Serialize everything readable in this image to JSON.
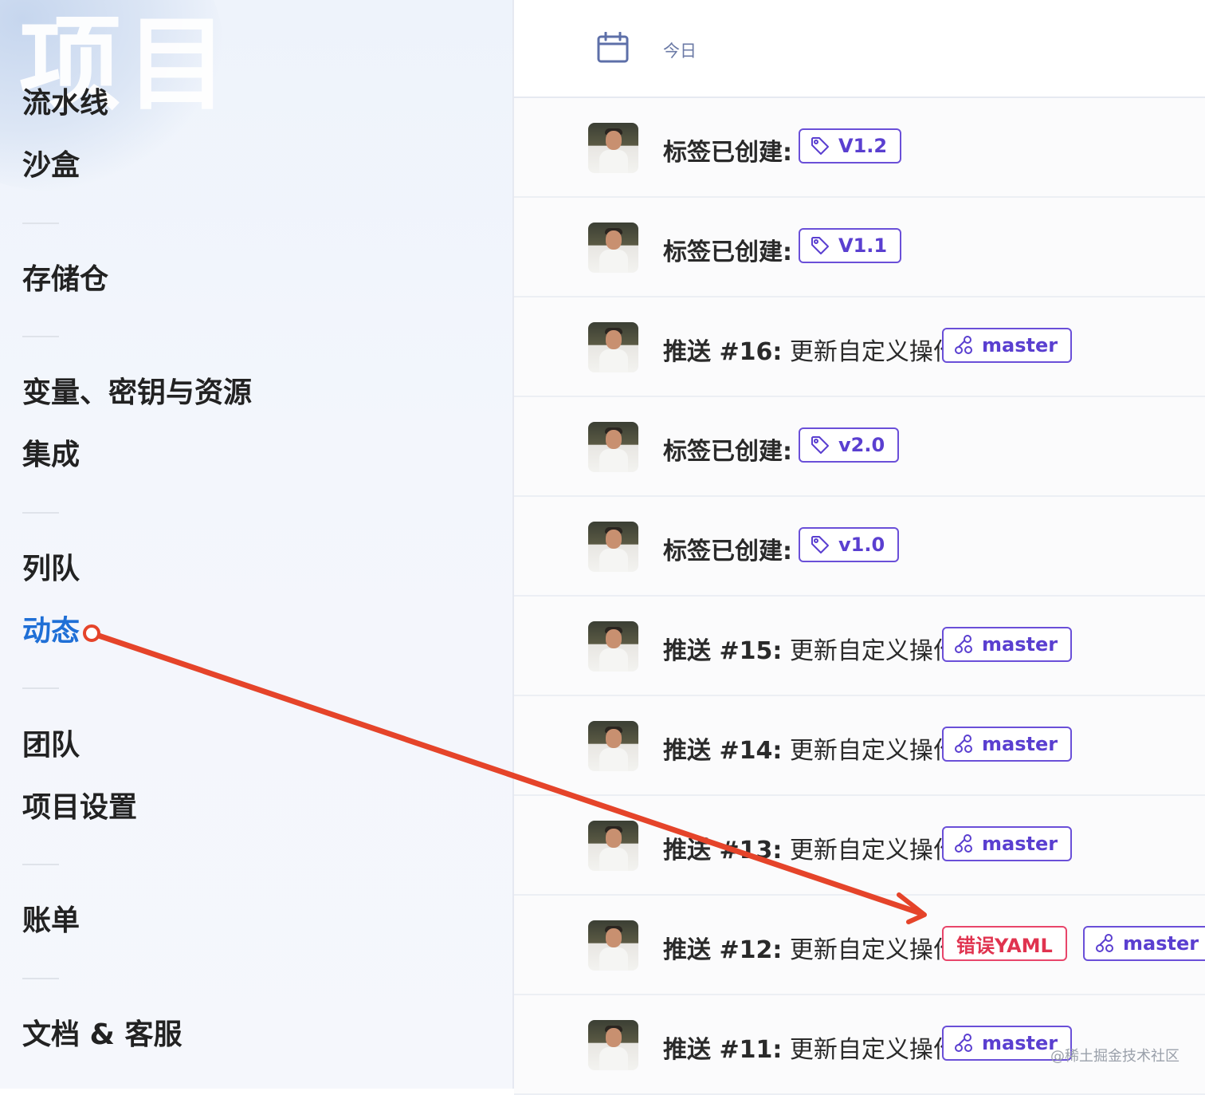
{
  "sidebar": {
    "big_title": "项目",
    "items": [
      {
        "label": "流水线"
      },
      {
        "label": "沙盒"
      },
      {
        "label": "存储仓"
      },
      {
        "label": "变量、密钥与资源"
      },
      {
        "label": "集成"
      },
      {
        "label": "列队"
      },
      {
        "label": "动态"
      },
      {
        "label": "团队"
      },
      {
        "label": "项目设置"
      },
      {
        "label": "账单"
      },
      {
        "label": "文档 & 客服"
      }
    ],
    "active_item": "动态"
  },
  "header": {
    "date_label": "今日",
    "icon": "calendar-icon"
  },
  "feed": [
    {
      "prefix": "标签已创建:",
      "suffix": "",
      "tags": [
        {
          "label": "V1.2",
          "icon": "tag-icon"
        }
      ]
    },
    {
      "prefix": "标签已创建:",
      "suffix": "",
      "tags": [
        {
          "label": "V1.1",
          "icon": "tag-icon"
        }
      ]
    },
    {
      "prefix": "推送 #16:",
      "suffix": " 更新自定义操作",
      "tags": [
        {
          "label": "master",
          "icon": "branch-icon"
        }
      ]
    },
    {
      "prefix": "标签已创建:",
      "suffix": "",
      "tags": [
        {
          "label": "v2.0",
          "icon": "tag-icon"
        }
      ]
    },
    {
      "prefix": "标签已创建:",
      "suffix": "",
      "tags": [
        {
          "label": "v1.0",
          "icon": "tag-icon"
        }
      ]
    },
    {
      "prefix": "推送 #15:",
      "suffix": " 更新自定义操作",
      "tags": [
        {
          "label": "master",
          "icon": "branch-icon"
        }
      ]
    },
    {
      "prefix": "推送 #14:",
      "suffix": " 更新自定义操作",
      "tags": [
        {
          "label": "master",
          "icon": "branch-icon"
        }
      ]
    },
    {
      "prefix": "推送 #13:",
      "suffix": " 更新自定义操作",
      "tags": [
        {
          "label": "master",
          "icon": "branch-icon"
        }
      ]
    },
    {
      "prefix": "推送 #12:",
      "suffix": " 更新自定义操作",
      "tags": [
        {
          "label": "错误YAML",
          "icon": "",
          "status": "error"
        },
        {
          "label": "master",
          "icon": "branch-icon"
        }
      ]
    },
    {
      "prefix": "推送 #11:",
      "suffix": " 更新自定义操作",
      "tags": [
        {
          "label": "master",
          "icon": "branch-icon"
        }
      ]
    }
  ],
  "colors": {
    "accent": "#6a4fd8",
    "active_nav": "#1f6fd6",
    "error": "#e0334f",
    "annotation_arrow": "#e5442a"
  },
  "watermark": "@稀土掘金技术社区"
}
